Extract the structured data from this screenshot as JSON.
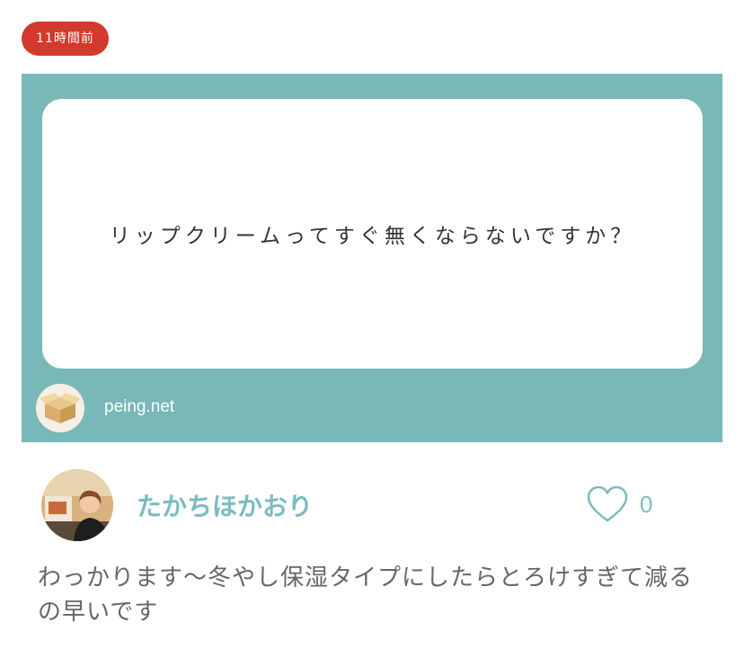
{
  "time_badge": "11時間前",
  "question": {
    "text": "リップクリームってすぐ無くならないですか？",
    "source": "peing.net"
  },
  "answer": {
    "user_name": "たかちほかおり",
    "like_count": "0",
    "text": "わっかります〜冬やし保湿タイプにしたらとろけすぎて減るの早いです"
  },
  "colors": {
    "badge": "#d13a2c",
    "card_bg": "#78b8b9",
    "accent": "#7bbcc0",
    "body_text": "#666666"
  }
}
